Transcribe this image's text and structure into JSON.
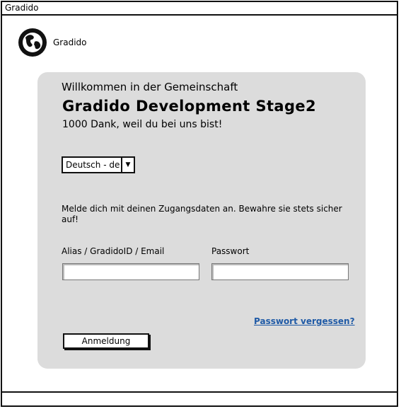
{
  "window": {
    "title": "Gradido"
  },
  "header": {
    "logo_text": "Gradido"
  },
  "panel": {
    "welcome": "Willkommen in der Gemeinschaft",
    "title": "Gradido Development Stage2",
    "subtitle": "1000 Dank, weil du bei uns bist!",
    "language_select": {
      "value": "Deutsch - de"
    },
    "info": "Melde dich mit deinen Zugangsdaten an. Bewahre sie stets sicher auf!",
    "fields": {
      "alias_label": "Alias / GradidoID / Email",
      "alias_value": "",
      "password_label": "Passwort",
      "password_value": ""
    },
    "forgot_password": "Passwort vergessen?",
    "login_button": "Anmeldung"
  },
  "colors": {
    "panel_bg": "#dcdcdc",
    "link": "#1f5aa6"
  },
  "icons": {
    "logo": "globe-icon",
    "dropdown": "caret-down-icon"
  }
}
